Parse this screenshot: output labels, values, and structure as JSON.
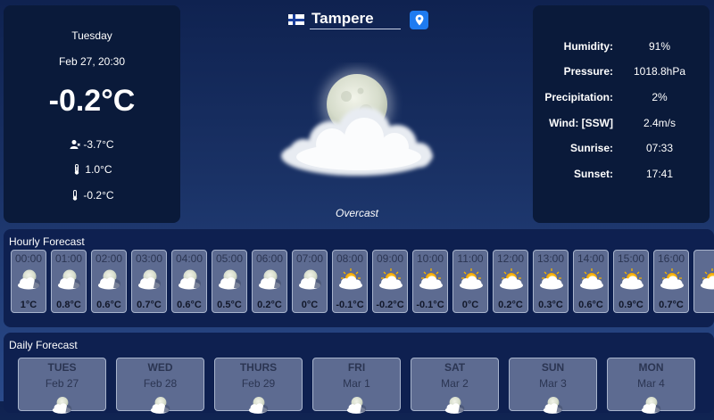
{
  "current": {
    "day": "Tuesday",
    "datetime": "Feb 27, 20:30",
    "temperature": "-0.2°C",
    "feels_like": "-3.7°C",
    "temp_high": "1.0°C",
    "temp_low": "-0.2°C",
    "condition": "Overcast",
    "icon": "moon-cloud-icon"
  },
  "location": {
    "city": "Tampere",
    "flag": "finland-flag",
    "locate_icon": "location-pin-icon"
  },
  "stats": [
    {
      "label": "Humidity:",
      "value": "91%"
    },
    {
      "label": "Pressure:",
      "value": "1018.8hPa"
    },
    {
      "label": "Precipitation:",
      "value": "2%"
    },
    {
      "label": "Wind: [SSW]",
      "value": "2.4m/s"
    },
    {
      "label": "Sunrise:",
      "value": "07:33"
    },
    {
      "label": "Sunset:",
      "value": "17:41"
    }
  ],
  "hourly": {
    "title": "Hourly Forecast",
    "items": [
      {
        "time": "00:00",
        "temp": "1°C",
        "icon": "moon-cloud-icon"
      },
      {
        "time": "01:00",
        "temp": "0.8°C",
        "icon": "moon-cloud-icon"
      },
      {
        "time": "02:00",
        "temp": "0.6°C",
        "icon": "moon-cloud-icon"
      },
      {
        "time": "03:00",
        "temp": "0.7°C",
        "icon": "moon-cloud-icon"
      },
      {
        "time": "04:00",
        "temp": "0.6°C",
        "icon": "moon-cloud-icon"
      },
      {
        "time": "05:00",
        "temp": "0.5°C",
        "icon": "moon-cloud-icon"
      },
      {
        "time": "06:00",
        "temp": "0.2°C",
        "icon": "moon-cloud-icon"
      },
      {
        "time": "07:00",
        "temp": "0°C",
        "icon": "moon-cloud-icon"
      },
      {
        "time": "08:00",
        "temp": "-0.1°C",
        "icon": "sun-cloud-icon"
      },
      {
        "time": "09:00",
        "temp": "-0.2°C",
        "icon": "sun-cloud-icon"
      },
      {
        "time": "10:00",
        "temp": "-0.1°C",
        "icon": "sun-cloud-icon"
      },
      {
        "time": "11:00",
        "temp": "0°C",
        "icon": "sun-cloud-icon"
      },
      {
        "time": "12:00",
        "temp": "0.2°C",
        "icon": "sun-cloud-icon"
      },
      {
        "time": "13:00",
        "temp": "0.3°C",
        "icon": "sun-cloud-icon"
      },
      {
        "time": "14:00",
        "temp": "0.6°C",
        "icon": "sun-cloud-icon"
      },
      {
        "time": "15:00",
        "temp": "0.9°C",
        "icon": "sun-cloud-icon"
      },
      {
        "time": "16:00",
        "temp": "0.7°C",
        "icon": "sun-cloud-icon"
      },
      {
        "time": "",
        "temp": "",
        "icon": "sun-cloud-icon"
      }
    ]
  },
  "daily": {
    "title": "Daily Forecast",
    "items": [
      {
        "name": "TUES",
        "date": "Feb 27",
        "icon": "moon-cloud-icon"
      },
      {
        "name": "WED",
        "date": "Feb 28",
        "icon": "moon-cloud-icon"
      },
      {
        "name": "THURS",
        "date": "Feb 29",
        "icon": "moon-cloud-icon"
      },
      {
        "name": "FRI",
        "date": "Mar 1",
        "icon": "moon-cloud-icon"
      },
      {
        "name": "SAT",
        "date": "Mar 2",
        "icon": "moon-cloud-icon"
      },
      {
        "name": "SUN",
        "date": "Mar 3",
        "icon": "moon-cloud-icon"
      },
      {
        "name": "MON",
        "date": "Mar 4",
        "icon": "moon-cloud-icon"
      }
    ]
  }
}
